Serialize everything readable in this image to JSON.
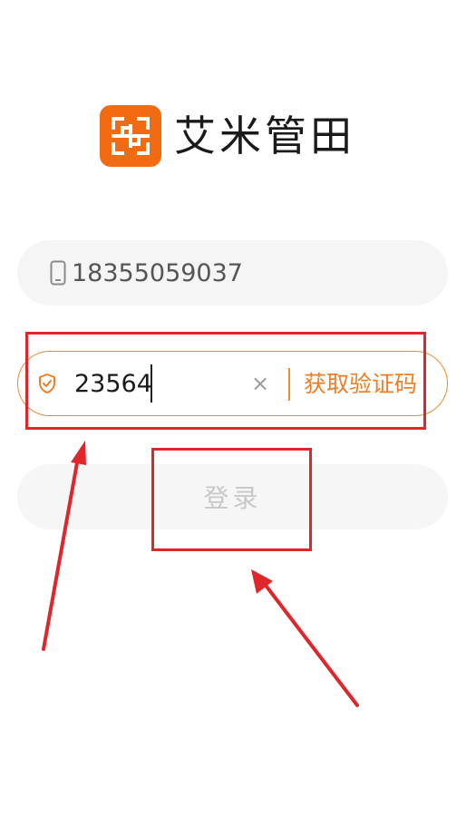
{
  "app": {
    "brand_name": "艾米管田",
    "logo_icon": "grid-frame-icon",
    "brand_color": "#f26b12"
  },
  "phone_field": {
    "icon": "phone-icon",
    "value": "18355059037"
  },
  "code_field": {
    "icon": "shield-check-icon",
    "value": "23564",
    "clear_icon": "close-icon",
    "clear_symbol": "×",
    "get_code_label": "获取验证码",
    "accent_color": "#ee7d25"
  },
  "login_button": {
    "label": "登录",
    "state": "disabled"
  },
  "annotations": {
    "color": "#e0262b"
  }
}
